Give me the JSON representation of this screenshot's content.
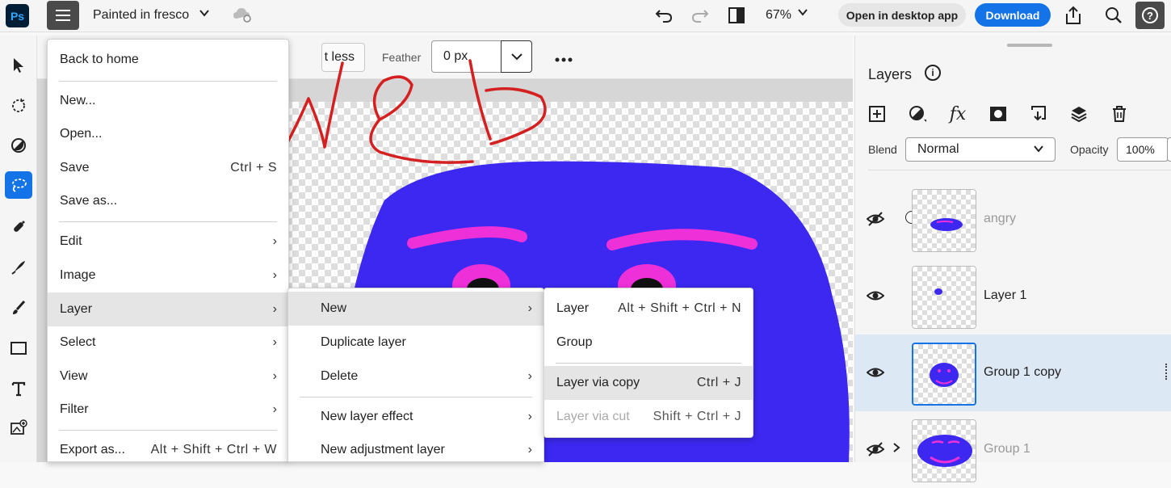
{
  "topbar": {
    "logo": "Ps",
    "doc_title": "Painted in fresco",
    "zoom": "67%",
    "open_desktop_label": "Open in desktop app",
    "download_label": "Download",
    "icons": [
      "menu-icon",
      "chevron-down-icon",
      "cloud-sync-icon",
      "undo-icon",
      "redo-icon",
      "compare-icon",
      "share-icon",
      "search-icon",
      "help-icon"
    ]
  },
  "tools": [
    "move-tool-icon",
    "quick-select-icon",
    "adjust-icon",
    "lasso-icon",
    "healing-icon",
    "spot-heal-icon",
    "brush-icon",
    "rectangle-icon",
    "type-icon",
    "add-image-icon"
  ],
  "options": {
    "less_label": "t less",
    "feather_label": "Feather",
    "feather_value": "0 px"
  },
  "main_menu": {
    "items": [
      {
        "label": "Back to home"
      },
      {
        "label": "New..."
      },
      {
        "label": "Open..."
      },
      {
        "label": "Save",
        "shortcut": "Ctrl + S"
      },
      {
        "label": "Save as..."
      },
      {
        "label": "Edit"
      },
      {
        "label": "Image"
      },
      {
        "label": "Layer"
      },
      {
        "label": "Select"
      },
      {
        "label": "View"
      },
      {
        "label": "Filter"
      },
      {
        "label": "Export as...",
        "shortcut": "Alt + Shift + Ctrl + W"
      }
    ]
  },
  "layer_menu": {
    "items": [
      {
        "label": "New"
      },
      {
        "label": "Duplicate layer"
      },
      {
        "label": "Delete"
      },
      {
        "label": "New layer effect"
      },
      {
        "label": "New adjustment layer"
      }
    ]
  },
  "new_menu": {
    "items": [
      {
        "label": "Layer",
        "shortcut": "Alt + Shift + Ctrl + N"
      },
      {
        "label": "Group"
      },
      {
        "label": "Layer via copy",
        "shortcut": "Ctrl + J"
      },
      {
        "label": "Layer via cut",
        "shortcut": "Shift + Ctrl + J"
      }
    ]
  },
  "layers_panel": {
    "title": "Layers",
    "blend_label": "Blend",
    "blend_value": "Normal",
    "opacity_label": "Opacity",
    "opacity_value": "100%",
    "toolbar_icons": [
      "add-layer-icon",
      "adjustment-icon",
      "fx-icon",
      "mask-icon",
      "clip-icon",
      "stack-icon",
      "trash-icon"
    ],
    "layers": [
      {
        "name": "angry",
        "visible": false
      },
      {
        "name": "Layer 1",
        "visible": true
      },
      {
        "name": "Group 1 copy",
        "visible": true,
        "selected": true
      },
      {
        "name": "Group 1",
        "visible": false
      }
    ]
  },
  "annotations": {
    "handwriting_word": "WED",
    "color": "#d42020"
  },
  "colors": {
    "accent": "#1473e6",
    "face_blue": "#3c28f0",
    "face_pink": "#ee30d8"
  }
}
